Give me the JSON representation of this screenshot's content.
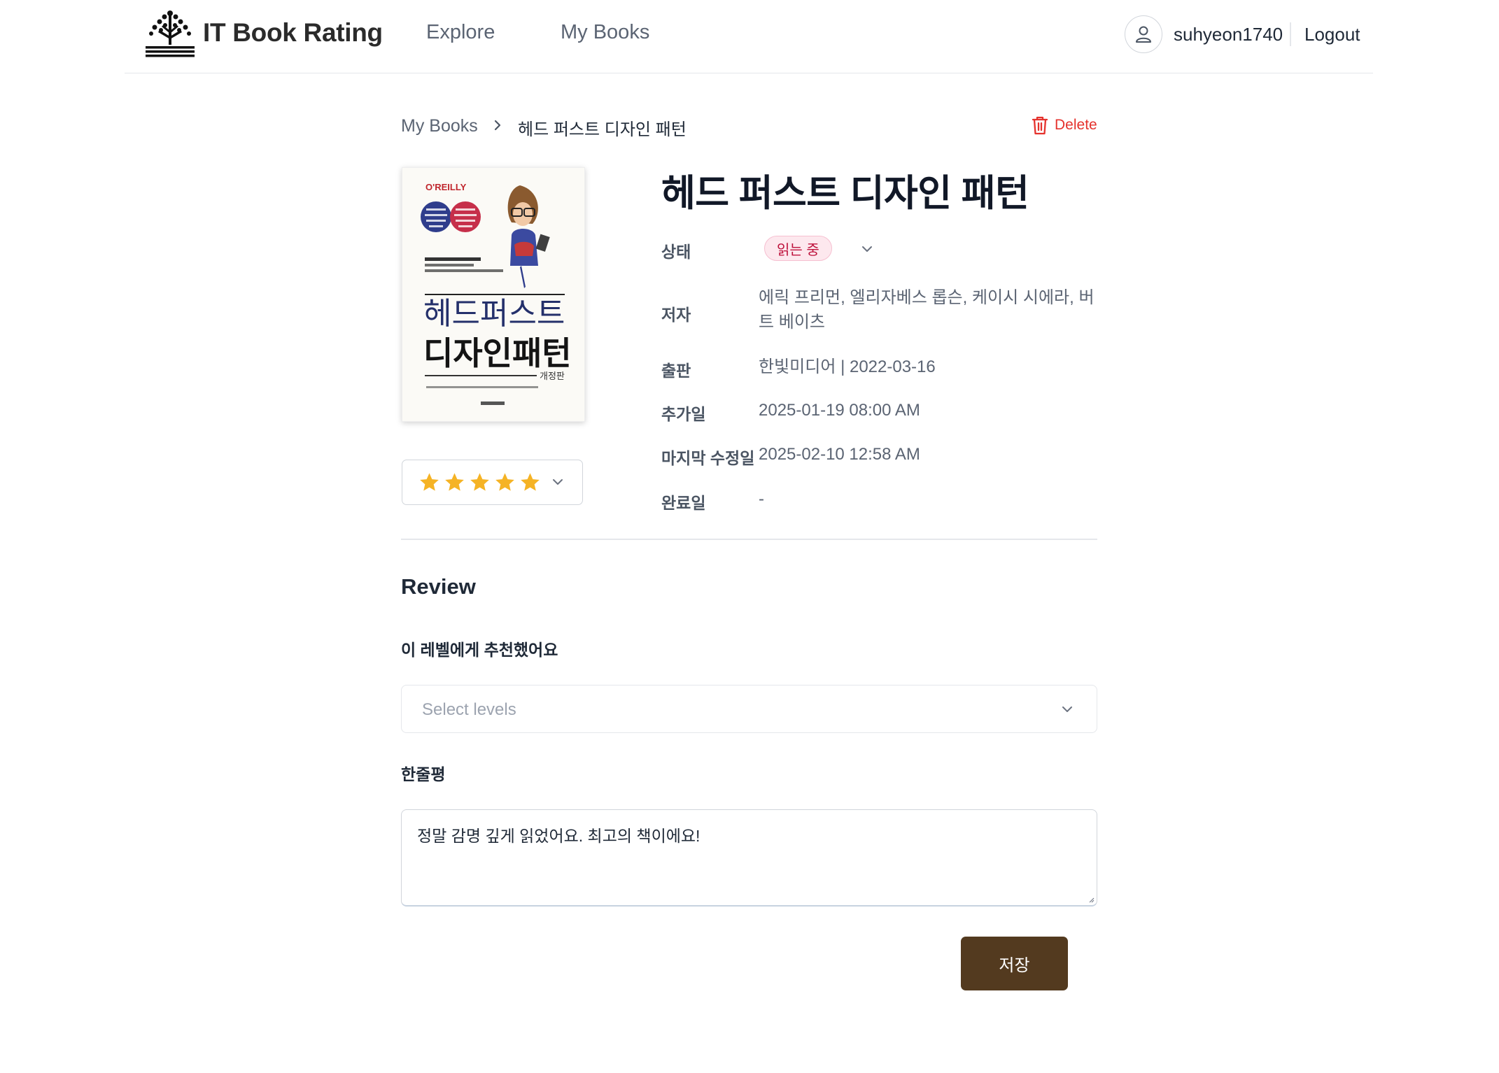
{
  "header": {
    "app_title": "IT Book Rating",
    "nav": [
      "Explore",
      "My Books"
    ],
    "username": "suhyeon1740",
    "logout_label": "Logout",
    "icons": {
      "logo": "tree-book-logo-icon",
      "user": "user-icon"
    }
  },
  "breadcrumb": {
    "parent": "My Books",
    "current": "헤드 퍼스트 디자인 패턴",
    "separator_icon": "chevron-right-icon"
  },
  "actions": {
    "delete_label": "Delete",
    "delete_icon": "trash-icon",
    "save_label": "저장"
  },
  "cover": {
    "publisher_mark": "O'REILLY",
    "title_line1": "헤드퍼스트",
    "title_line2": "디자인패턴",
    "edition": "개정판"
  },
  "rating": {
    "value": 5,
    "max": 5,
    "star_color": "#f5b325"
  },
  "book": {
    "title": "헤드 퍼스트 디자인 패턴",
    "status_label": "상태",
    "status_value": "읽는 중",
    "author_label": "저자",
    "author_value": "에릭 프리먼, 엘리자베스 롭슨, 케이시 시에라, 버트 베이츠",
    "publish_label": "출판",
    "publish_value": "한빛미디어 | 2022-03-16",
    "added_label": "추가일",
    "added_value": "2025-01-19 08:00 AM",
    "modified_label": "마지막 수정일",
    "modified_value": "2025-02-10 12:58 AM",
    "completed_label": "완료일",
    "completed_value": "-"
  },
  "review": {
    "heading": "Review",
    "levels_label": "이 레벨에게 추천했어요",
    "levels_placeholder": "Select levels",
    "oneline_label": "한줄평",
    "oneline_value": "정말 감명 깊게 읽었어요. 최고의 책이에요!"
  },
  "colors": {
    "delete": "#e5322d",
    "save_button": "#533a1f",
    "status_badge_bg": "#fde8ee",
    "status_badge_text": "#be123c"
  }
}
